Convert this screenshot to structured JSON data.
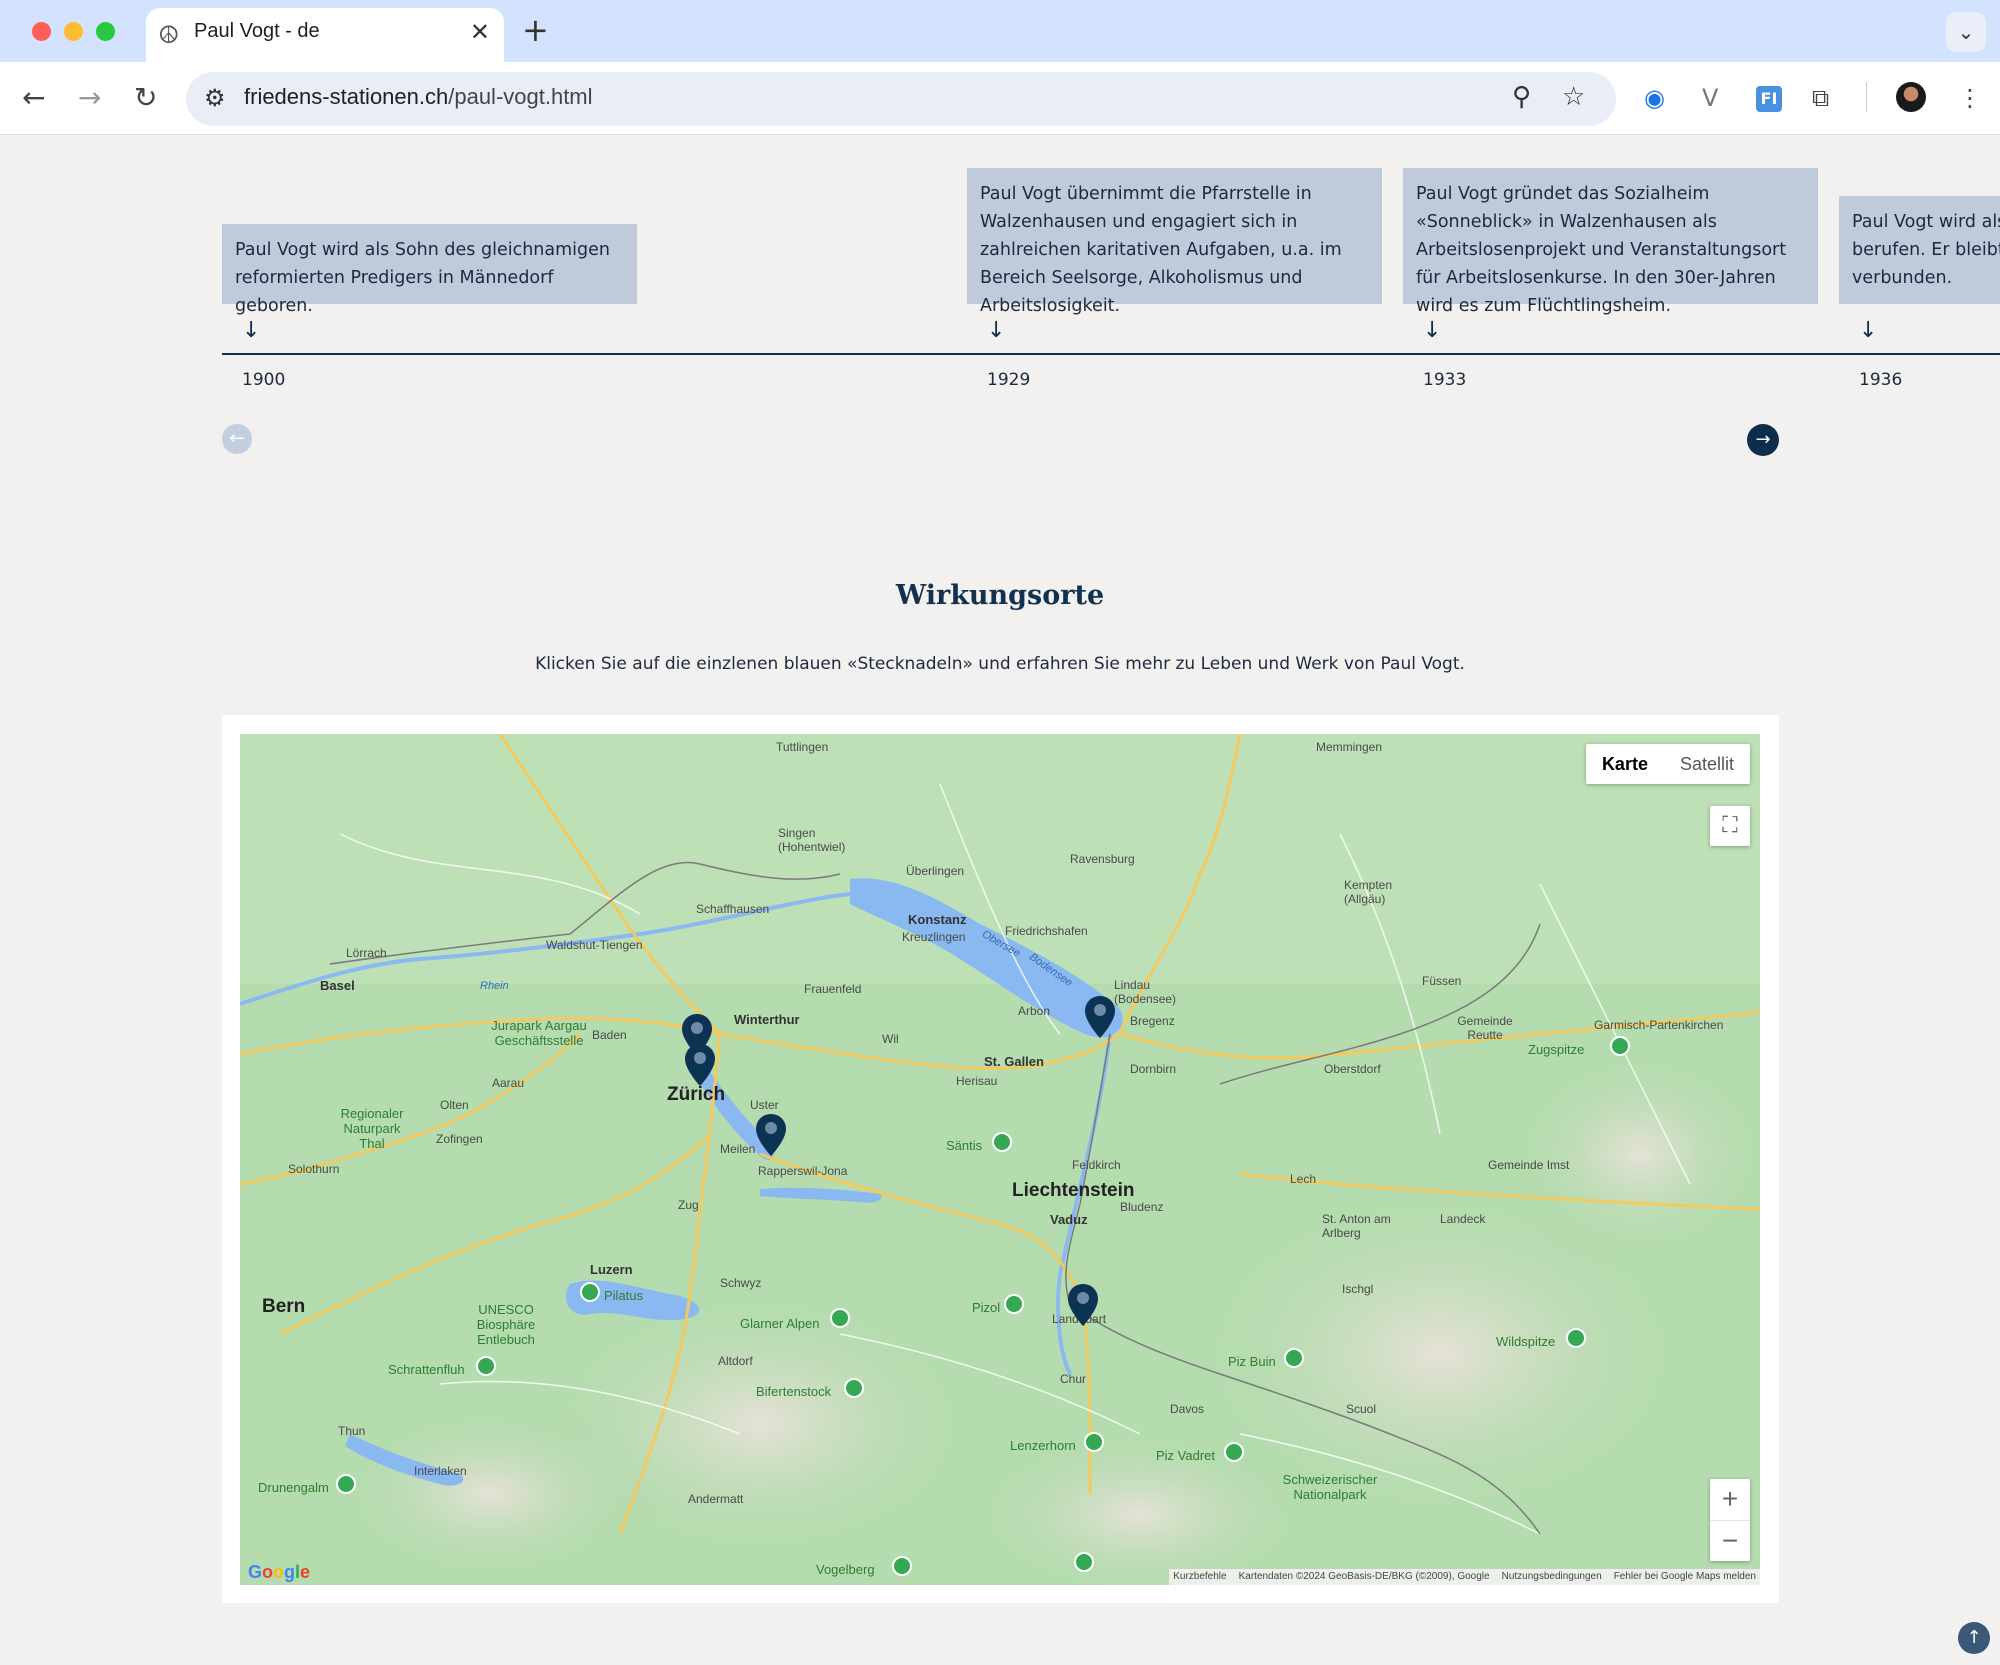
{
  "browser": {
    "tab_title": "Paul Vogt - de",
    "url_host": "friedens-stationen.ch",
    "url_path": "/paul-vogt.html",
    "icons": [
      "peace-favicon",
      "close-icon",
      "plus-icon",
      "chevron-down-icon",
      "back-icon",
      "forward-icon",
      "reload-icon",
      "tune-icon",
      "zoom-icon",
      "star-icon",
      "extension-icon",
      "profile-avatar",
      "menu-icon"
    ]
  },
  "timeline": {
    "events": [
      {
        "year": "1900",
        "text": "Paul Vogt wird als Sohn des gleichnamigen reformierten Predigers in Männedorf geboren."
      },
      {
        "year": "1929",
        "text": "Paul Vogt übernimmt die Pfarrstelle in Walzenhausen und engagiert sich in zahlreichen karitativen Aufgaben, u.a. im Bereich Seelsorge, Alkoholismus und Arbeitslosigkeit."
      },
      {
        "year": "1933",
        "text": "Paul Vogt gründet das Sozialheim «Sonneblick» in Walzenhausen als Arbeitslosenprojekt und Veranstaltungsort für Arbeitslosenkurse. In den 30er-Jahren wird es zum Flüchtlingsheim."
      },
      {
        "year": "1936",
        "text": "Paul Vogt wird als P berufen. Er bleibt m verbunden."
      }
    ],
    "arrow_glyph": "↓",
    "prev_glyph": "←",
    "next_glyph": "→"
  },
  "section": {
    "title": "Wirkungsorte",
    "subtitle": "Klicken Sie auf die einzlenen blauen «Stecknadeln» und erfahren Sie mehr zu Leben und Werk von Paul Vogt."
  },
  "map": {
    "type_buttons": [
      "Karte",
      "Satellit"
    ],
    "zoom_in": "+",
    "zoom_out": "−",
    "fullscreen_glyph": "⛶",
    "footer": [
      "Kurzbefehle",
      "Kartendaten ©2024 GeoBasis-DE/BKG (©2009), Google",
      "Nutzungsbedingungen",
      "Fehler bei Google Maps melden"
    ],
    "logo": "Google",
    "place_labels": {
      "zuerich": "Zürich",
      "liechtenstein": "Liechtenstein",
      "bern": "Bern",
      "luzern": "Luzern",
      "basel": "Basel",
      "winterthur": "Winterthur",
      "stgallen": "St. Gallen",
      "konstanz": "Konstanz",
      "schaffhausen": "Schaffhausen",
      "bregenz": "Bregenz",
      "chur": "Chur",
      "vaduz": "Vaduz",
      "davos": "Davos",
      "uster": "Uster",
      "meilen": "Meilen",
      "rapperswil": "Rapperswil-Jona",
      "arbon": "Arbon",
      "friedrichshafen": "Friedrichshafen",
      "lindau": "Lindau (Bodensee)",
      "dornbirn": "Dornbirn",
      "feldkirch": "Feldkirch",
      "baden": "Baden",
      "aarau": "Aarau",
      "zug": "Zug",
      "schwyz": "Schwyz",
      "altdorf": "Altdorf",
      "glarus": "Glarner Alpen",
      "landquart": "Landquart",
      "ravensburg": "Ravensburg",
      "kempten": "Kempten (Allgäu)",
      "fuessen": "Füssen",
      "memmingen": "Memmingen",
      "tuttlingen": "Tuttlingen",
      "singen": "Singen (Hohentwiel)",
      "frauenfeld": "Frauenfeld",
      "wil": "Wil",
      "herisau": "Herisau",
      "kreuzlingen": "Kreuzlingen",
      "ueberlingen": "Überlingen",
      "thun": "Thun",
      "interlaken": "Interlaken",
      "andermatt": "Andermatt",
      "landeck": "Landeck",
      "scuol": "Scuol",
      "zugspitze": "Zugspitze",
      "saentis": "Säntis",
      "pilatus": "Pilatus",
      "bodensee": "Bodensee",
      "obersee": "Obersee",
      "rhein": "Rhein",
      "olten": "Olten",
      "zofingen": "Zofingen",
      "solothurn": "Solothurn",
      "lenzerhorn": "Lenzerhorn",
      "wildspitze": "Wildspitze",
      "piz_buin": "Piz Buin",
      "pizol": "Pizol",
      "bifertenstock": "Bifertenstock",
      "drunengalm": "Drunengalm",
      "schrattenfluh": "Schrattenfluh",
      "unesco": "UNESCO Biosphäre Entlebuch",
      "jurapark": "Jurapark Aargau Geschäftsstelle",
      "naturpark": "Regionaler Naturpark Thal",
      "vogelberg": "Vogelberg",
      "piz_vadret": "Piz Vadret",
      "schweizer_np": "Schweizerischer Nationalpark",
      "bludenz": "Bludenz",
      "lech": "Lech",
      "imst": "Gemeinde Imst",
      "reutte": "Gemeinde Reutte",
      "garmisch": "Garmisch-Partenkirchen",
      "st_anton": "St. Anton am Arlberg",
      "ischgl": "Ischgl",
      "oberstdorf": "Oberstdorf",
      "waldshut": "Waldshut-Tiengen",
      "loerrach": "Lörrach"
    },
    "colors": {
      "land": "#a9d7a5",
      "water": "#8ab8f0",
      "road": "#f4c95d",
      "pin": "#0d3354",
      "poi": "#34a853"
    }
  },
  "scroll_top_glyph": "↑"
}
